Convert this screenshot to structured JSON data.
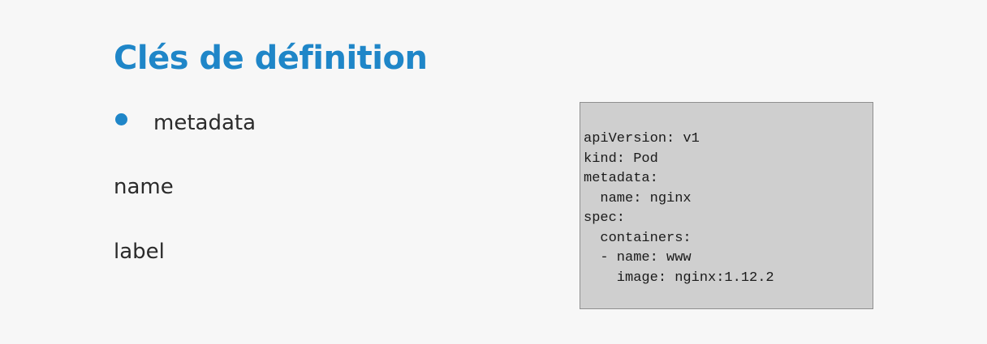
{
  "slide": {
    "title": "Clés de définition",
    "bullet": "metadata",
    "items": [
      "name",
      "label"
    ]
  },
  "code": {
    "yaml": "apiVersion: v1\nkind: Pod\nmetadata:\n  name: nginx\nspec:\n  containers:\n  - name: www\n    image: nginx:1.12.2"
  },
  "colors": {
    "accent": "#1f86c8",
    "background": "#f7f7f7",
    "code_background": "#cfcfcf"
  }
}
